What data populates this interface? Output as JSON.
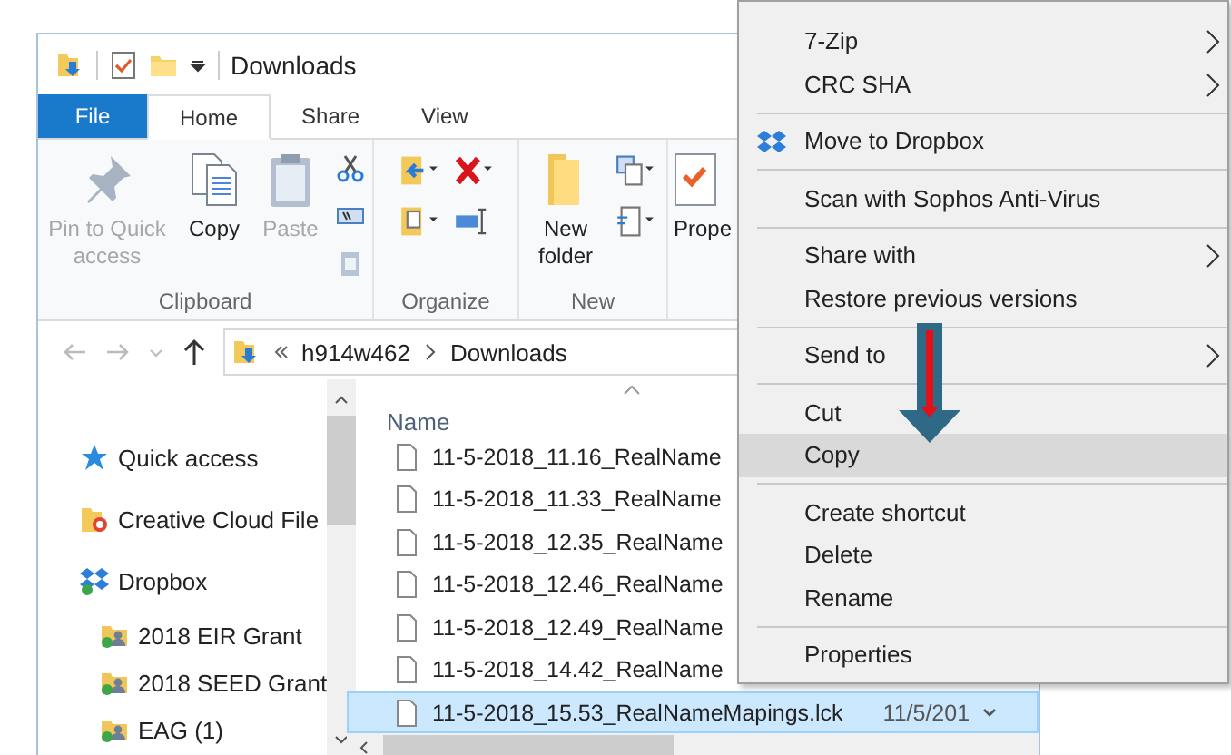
{
  "window": {
    "title": "Downloads"
  },
  "tabs": [
    {
      "label": "File",
      "kind": "file",
      "selected": false
    },
    {
      "label": "Home",
      "kind": "tab",
      "selected": true
    },
    {
      "label": "Share",
      "kind": "tab",
      "selected": false
    },
    {
      "label": "View",
      "kind": "tab",
      "selected": false
    }
  ],
  "ribbon_groups": [
    {
      "kind": "clipboard",
      "label": "Clipboard",
      "buttons": [
        {
          "kind": "pin",
          "label": "Pin to Quick access",
          "disabled": true
        },
        {
          "kind": "copy",
          "label": "Copy",
          "disabled": false
        },
        {
          "kind": "paste",
          "label": "Paste",
          "disabled": true
        }
      ]
    },
    {
      "kind": "organize",
      "label": "Organize"
    },
    {
      "kind": "new",
      "label": "New",
      "buttons": [
        {
          "kind": "folder",
          "label": "New folder",
          "disabled": false
        }
      ]
    },
    {
      "kind": "open",
      "buttons": [
        {
          "kind": "properties",
          "label": "Prope",
          "disabled": false
        }
      ]
    }
  ],
  "address": {
    "segments": [
      "h914w462",
      "Downloads"
    ]
  },
  "nav": [
    {
      "kind": "star",
      "label": "Quick access"
    },
    {
      "kind": "cloud",
      "label": "Creative Cloud File"
    },
    {
      "kind": "dropbox",
      "label": "Dropbox",
      "children": [
        {
          "kind": "shared",
          "label": "2018 EIR Grant"
        },
        {
          "kind": "shared",
          "label": "2018 SEED Grant"
        },
        {
          "kind": "shared",
          "label": "EAG (1)"
        }
      ]
    }
  ],
  "files": {
    "column": "Name",
    "rows": [
      {
        "name": "11-5-2018_11.16_RealName",
        "selected": false
      },
      {
        "name": "11-5-2018_11.33_RealName",
        "selected": false
      },
      {
        "name": "11-5-2018_12.35_RealName",
        "selected": false
      },
      {
        "name": "11-5-2018_12.46_RealName",
        "selected": false
      },
      {
        "name": "11-5-2018_12.49_RealName",
        "selected": false
      },
      {
        "name": "11-5-2018_14.42_RealName",
        "selected": false
      },
      {
        "name": "11-5-2018_15.53_RealNameMapings.lck",
        "modified": "11/5/201",
        "selected": true
      }
    ]
  },
  "context_menu": {
    "sections": [
      [
        {
          "label": "7-Zip",
          "submenu": true,
          "selected": false
        },
        {
          "label": "CRC SHA",
          "submenu": true,
          "selected": false
        }
      ],
      [
        {
          "label": "Move to Dropbox",
          "kind": "dropbox",
          "submenu": false,
          "selected": false
        }
      ],
      [
        {
          "label": "Scan with Sophos Anti-Virus",
          "submenu": false,
          "selected": false
        }
      ],
      [
        {
          "label": "Share with",
          "submenu": true,
          "selected": false
        },
        {
          "label": "Restore previous versions",
          "submenu": false,
          "selected": false
        }
      ],
      [
        {
          "label": "Send to",
          "submenu": true,
          "selected": false
        }
      ],
      [
        {
          "label": "Cut",
          "submenu": false,
          "selected": false
        },
        {
          "label": "Copy",
          "submenu": false,
          "selected": true
        }
      ],
      [
        {
          "label": "Create shortcut",
          "submenu": false,
          "selected": false
        },
        {
          "label": "Delete",
          "submenu": false,
          "selected": false
        },
        {
          "label": "Rename",
          "submenu": false,
          "selected": false
        }
      ],
      [
        {
          "label": "Properties",
          "submenu": false,
          "selected": false
        }
      ]
    ]
  }
}
